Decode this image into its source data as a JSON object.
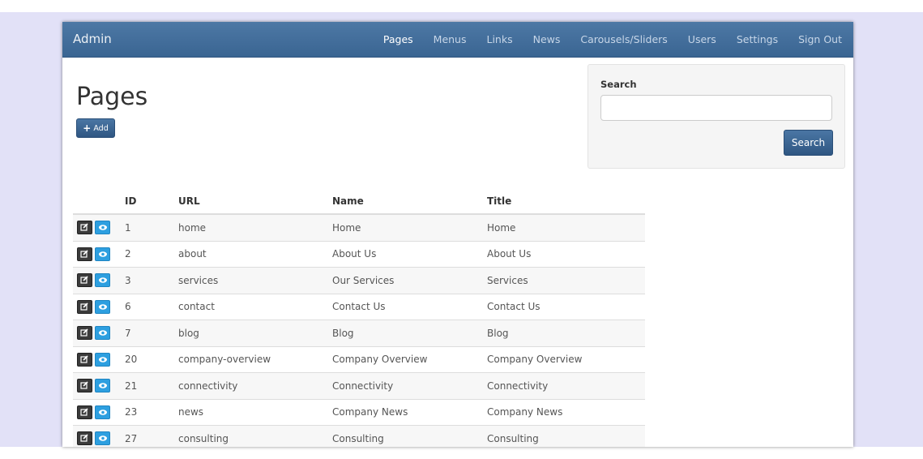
{
  "navbar": {
    "brand": "Admin",
    "links": [
      {
        "label": "Pages",
        "active": true
      },
      {
        "label": "Menus"
      },
      {
        "label": "Links"
      },
      {
        "label": "News"
      },
      {
        "label": "Carousels/Sliders"
      },
      {
        "label": "Users"
      },
      {
        "label": "Settings"
      },
      {
        "label": "Sign Out"
      }
    ]
  },
  "main": {
    "title": "Pages",
    "add_label": "Add"
  },
  "search": {
    "label": "Search",
    "input_value": "",
    "button_label": "Search"
  },
  "table": {
    "headers": {
      "id": "ID",
      "url": "URL",
      "name": "Name",
      "title": "Title"
    },
    "rows": [
      {
        "id": "1",
        "url": "home",
        "name": "Home",
        "title": "Home"
      },
      {
        "id": "2",
        "url": "about",
        "name": "About Us",
        "title": "About Us"
      },
      {
        "id": "3",
        "url": "services",
        "name": "Our Services",
        "title": "Services"
      },
      {
        "id": "6",
        "url": "contact",
        "name": "Contact Us",
        "title": "Contact Us"
      },
      {
        "id": "7",
        "url": "blog",
        "name": "Blog",
        "title": "Blog"
      },
      {
        "id": "20",
        "url": "company-overview",
        "name": "Company Overview",
        "title": "Company Overview"
      },
      {
        "id": "21",
        "url": "connectivity",
        "name": "Connectivity",
        "title": "Connectivity"
      },
      {
        "id": "23",
        "url": "news",
        "name": "Company News",
        "title": "Company News"
      },
      {
        "id": "27",
        "url": "consulting",
        "name": "Consulting",
        "title": "Consulting"
      }
    ]
  },
  "icons": {
    "edit": "edit-icon",
    "view": "eye-icon",
    "add": "plus-icon"
  },
  "colors": {
    "navbar": "#3f6b98",
    "primary_button": "#3a6592",
    "view_button": "#2d9fe0",
    "edit_button": "#3b3b3b",
    "page_background": "#e2e1f7"
  }
}
